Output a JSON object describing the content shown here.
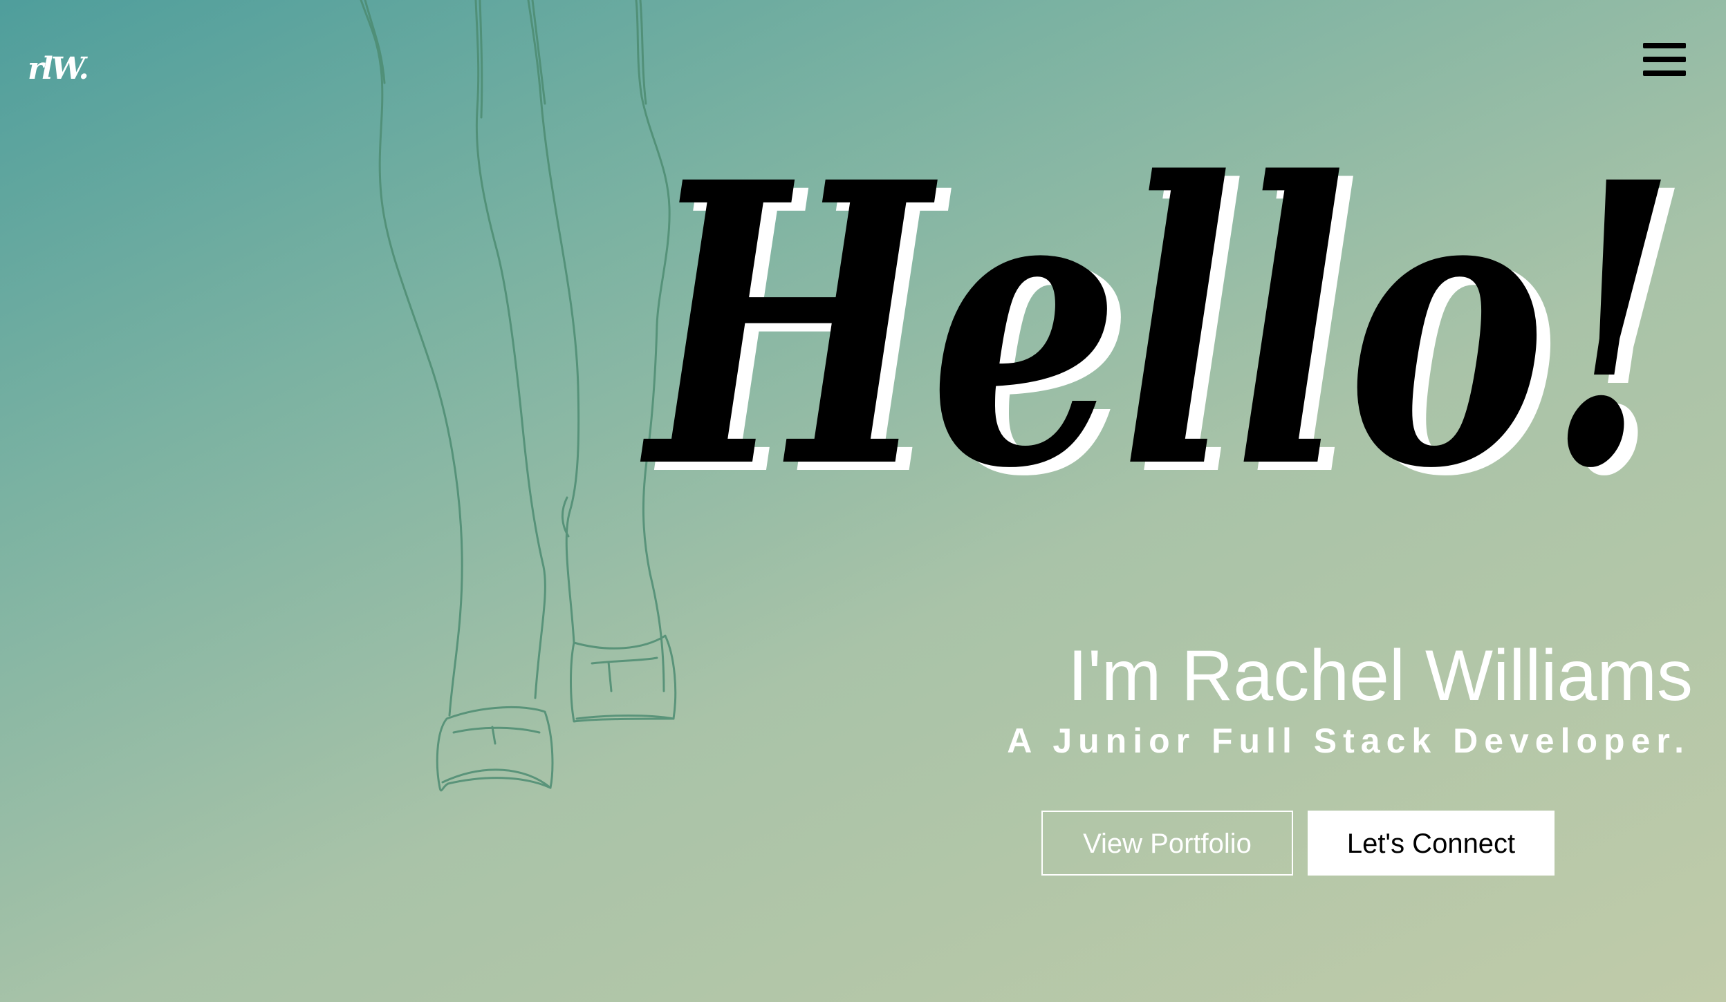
{
  "brand": {
    "logo_text": "rlW."
  },
  "nav": {
    "menu_icon": "hamburger-menu-icon"
  },
  "hero": {
    "greeting": "Hello!",
    "name_line": "I'm Rachel Williams",
    "role_line": "A Junior Full Stack Developer.",
    "background_image": "pencil-sketch-horse-legs"
  },
  "actions": {
    "portfolio_label": "View Portfolio",
    "connect_label": "Let's Connect"
  },
  "colors": {
    "gradient_start": "#4f9e9c",
    "gradient_end": "#c0cba9",
    "text": "#ffffff",
    "greeting": "#000000",
    "sketch_stroke": "#4d8c72"
  }
}
